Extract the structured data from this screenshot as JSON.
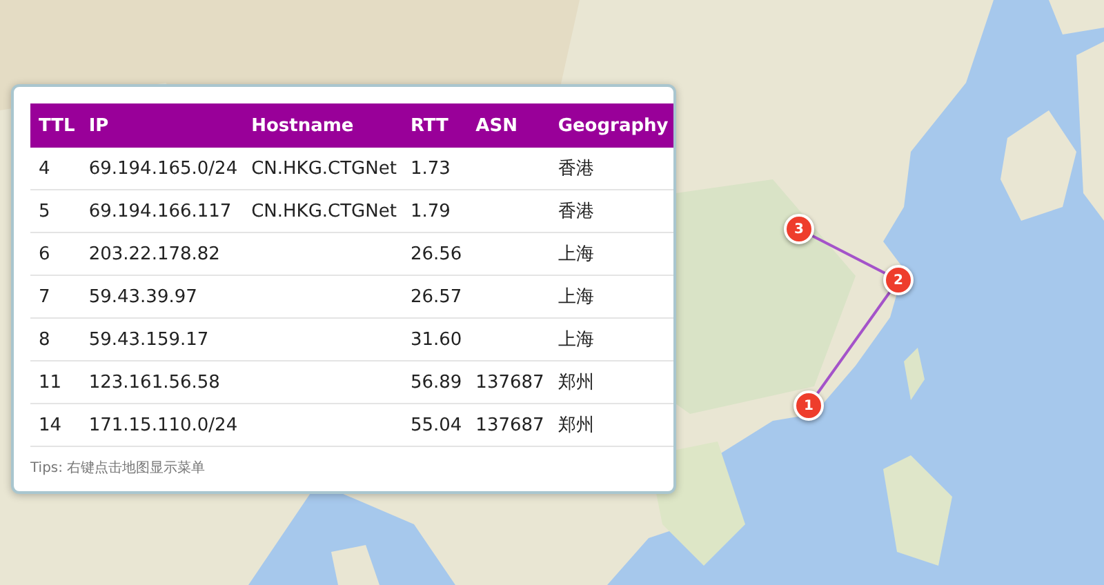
{
  "markers": [
    {
      "label": "1"
    },
    {
      "label": "2"
    },
    {
      "label": "3"
    }
  ],
  "table": {
    "columns": [
      "TTL",
      "IP",
      "Hostname",
      "RTT",
      "ASN",
      "Geography"
    ],
    "rows": [
      [
        "4",
        "69.194.165.0/24",
        "CN.HKG.CTGNet",
        "1.73",
        "",
        "香港"
      ],
      [
        "5",
        "69.194.166.117",
        "CN.HKG.CTGNet",
        "1.79",
        "",
        "香港"
      ],
      [
        "6",
        "203.22.178.82",
        "",
        "26.56",
        "",
        "上海"
      ],
      [
        "7",
        "59.43.39.97",
        "",
        "26.57",
        "",
        "上海"
      ],
      [
        "8",
        "59.43.159.17",
        "",
        "31.60",
        "",
        "上海"
      ],
      [
        "11",
        "123.161.56.58",
        "",
        "56.89",
        "137687",
        "郑州"
      ],
      [
        "14",
        "171.15.110.0/24",
        "",
        "55.04",
        "137687",
        "郑州"
      ]
    ]
  },
  "tips": "Tips: 右键点击地图显示菜单"
}
